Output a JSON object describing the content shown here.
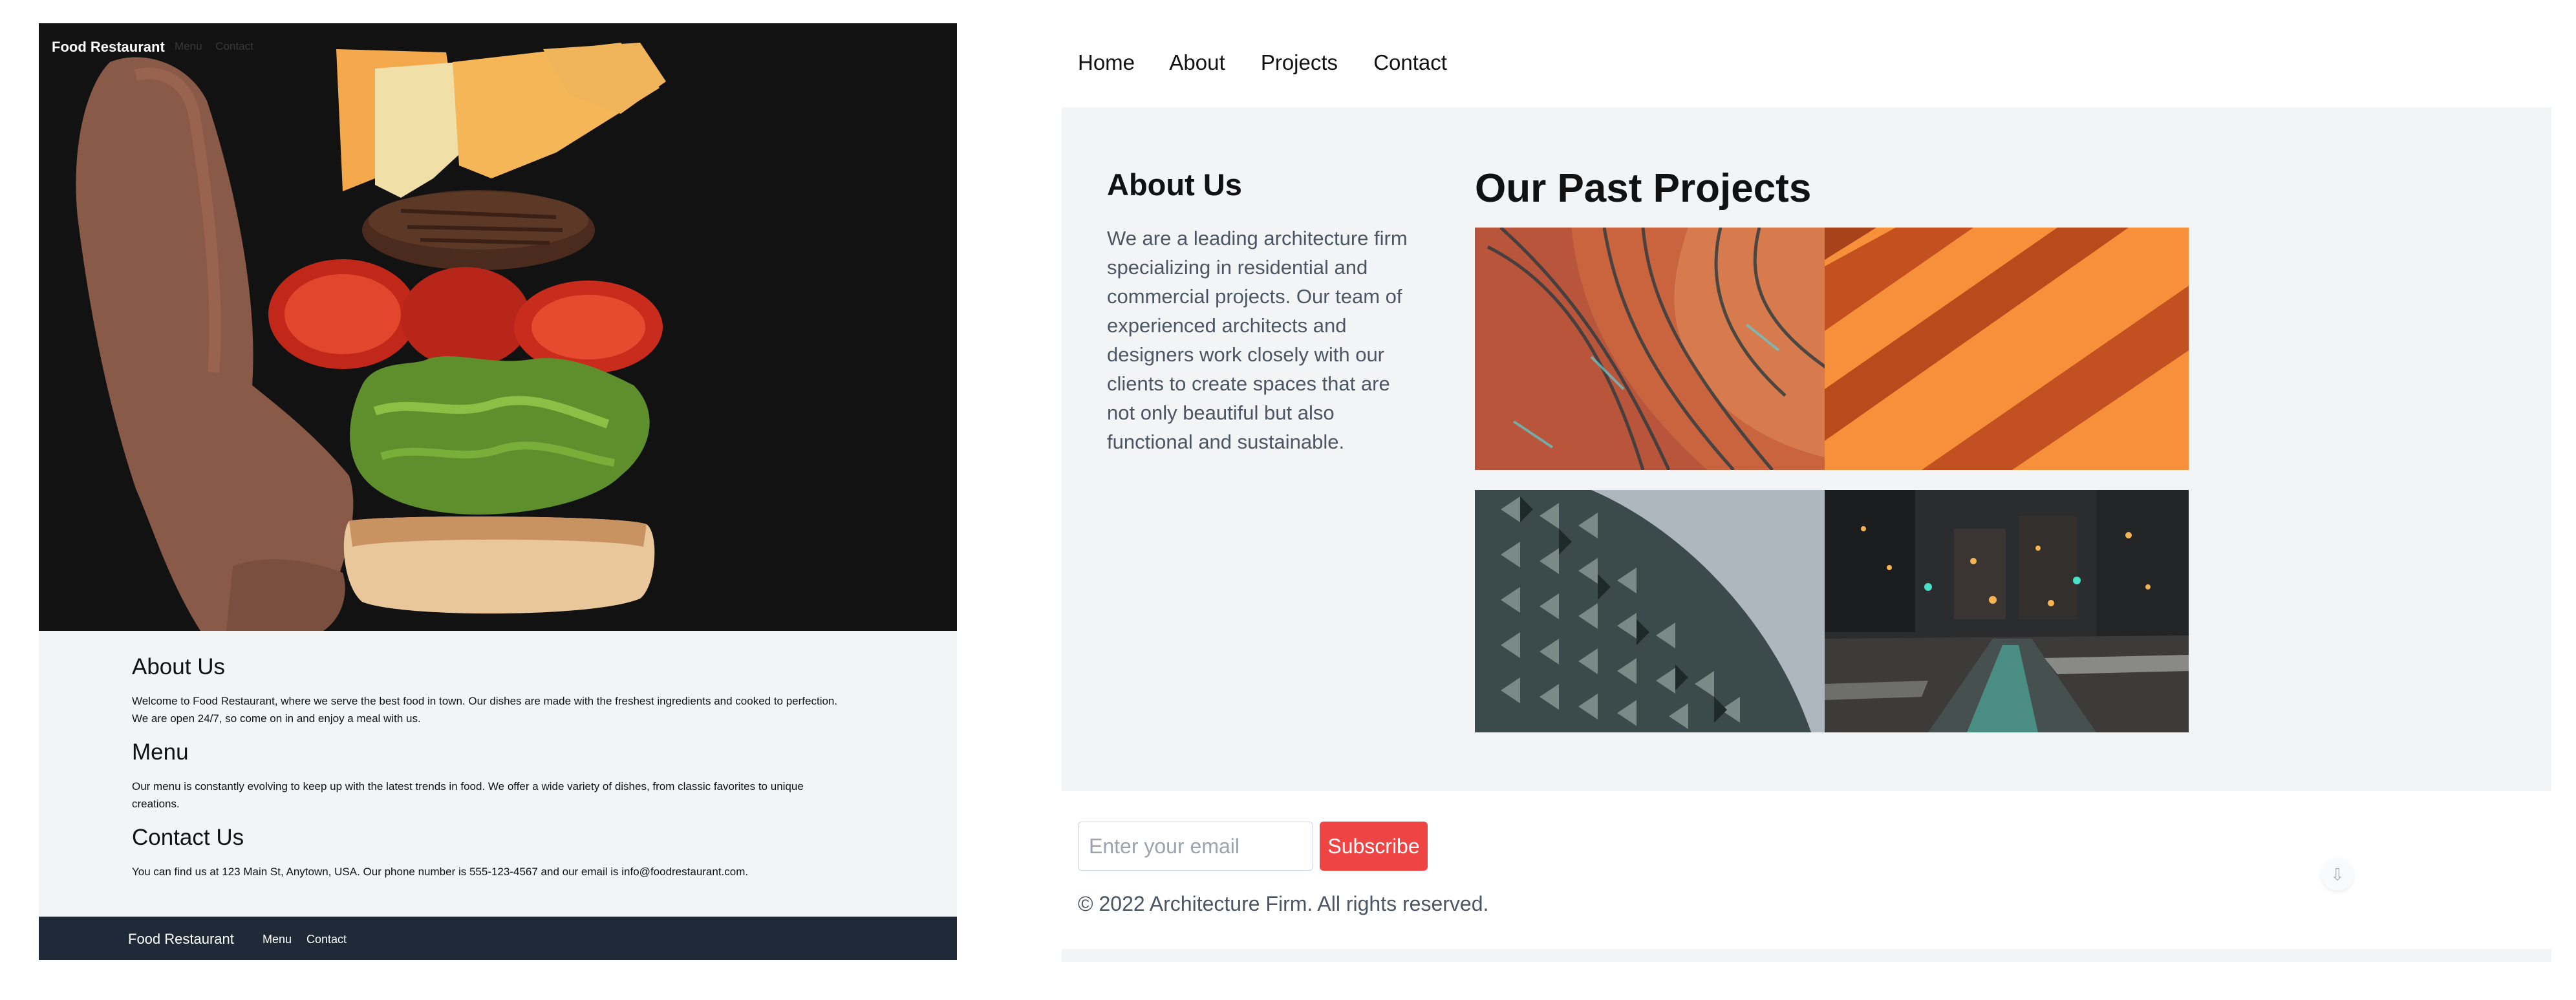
{
  "food": {
    "brand": "Food Restaurant",
    "nav": [
      "Menu",
      "Contact"
    ],
    "sections": [
      {
        "title": "About Us",
        "text": "Welcome to Food Restaurant, where we serve the best food in town. Our dishes are made with the freshest ingredients and cooked to perfection. We are open 24/7, so come on in and enjoy a meal with us."
      },
      {
        "title": "Menu",
        "text": "Our menu is constantly evolving to keep up with the latest trends in food. We offer a wide variety of dishes, from classic favorites to unique creations."
      },
      {
        "title": "Contact Us",
        "text": "You can find us at 123 Main St, Anytown, USA. Our phone number is 555-123-4567 and our email is info@foodrestaurant.com."
      }
    ],
    "footer": {
      "brand": "Food Restaurant",
      "links": [
        "Menu",
        "Contact"
      ]
    }
  },
  "arch": {
    "nav": [
      "Home",
      "About",
      "Projects",
      "Contact"
    ],
    "about": {
      "title": "About Us",
      "text": "We are a leading architecture firm specializing in residential and commercial projects. Our team of experienced architects and designers work closely with our clients to create spaces that are not only beautiful but also functional and sustainable."
    },
    "projects_title": "Our Past Projects",
    "projects": [
      {
        "image": "curved-facade-building"
      },
      {
        "image": "orange-wall-shadows"
      },
      {
        "image": "spiky-dome-building"
      },
      {
        "image": "night-city-street"
      }
    ],
    "newsletter": {
      "placeholder": "Enter your email",
      "button": "Subscribe"
    },
    "copyright": "© 2022 Architecture Firm. All rights reserved.",
    "scroll_icon": "arrow-down-icon"
  },
  "colors": {
    "accent_red": "#ef4444",
    "food_footer": "#1f2937",
    "section_bg": "#f3f4f6"
  }
}
